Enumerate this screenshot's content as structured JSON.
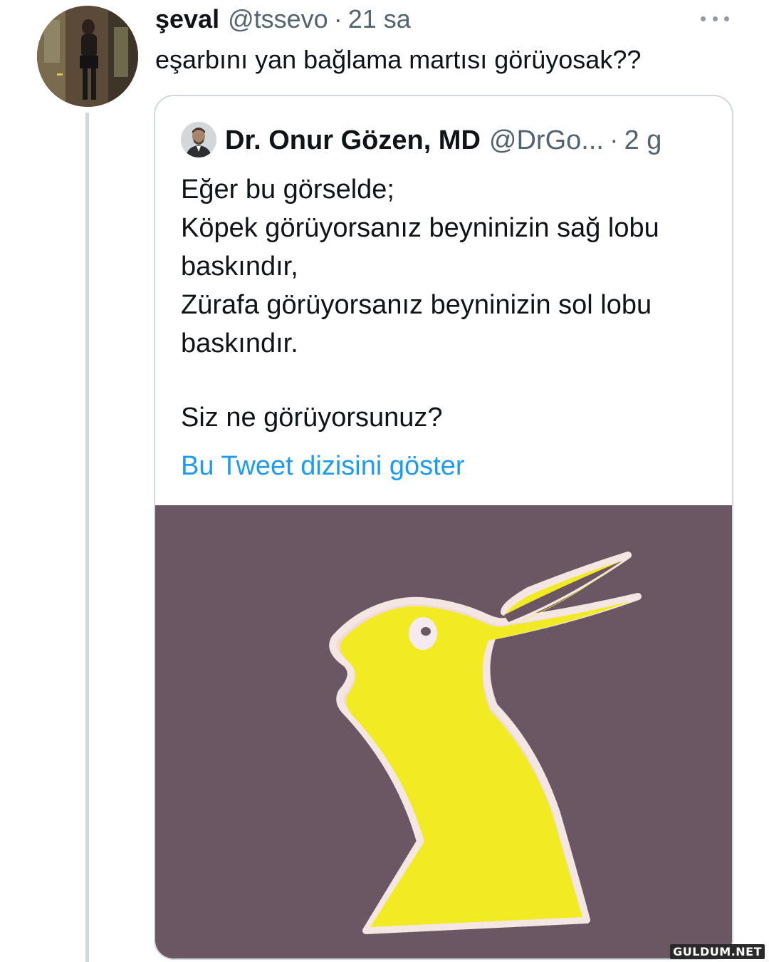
{
  "tweet": {
    "author_name": "şeval",
    "author_handle": "@tssevo",
    "separator": "·",
    "time": "21 sa",
    "text": "eşarbını yan bağlama martısı görüyosak??"
  },
  "quoted_tweet": {
    "author_name": "Dr. Onur Gözen, MD",
    "author_handle": "@DrGo...",
    "separator": "·",
    "time": "2 g",
    "lines": [
      "Eğer bu görselde;",
      "Köpek görüyorsanız beyninizin sağ lobu",
      "baskındır,",
      "Zürafa görüyorsanız beyninizin sol lobu",
      "baskındır."
    ],
    "question": "Siz ne görüyorsunuz?",
    "show_thread_link": "Bu Tweet dizisini göster"
  },
  "watermark": "GULDUM.NET",
  "icons": {
    "more": "more-horizontal-icon"
  },
  "colors": {
    "link": "#1d9bf0",
    "secondary_text": "#536471",
    "border": "#cfd9de",
    "media_background": "#6b5663",
    "figure_yellow": "#f2ea22"
  }
}
